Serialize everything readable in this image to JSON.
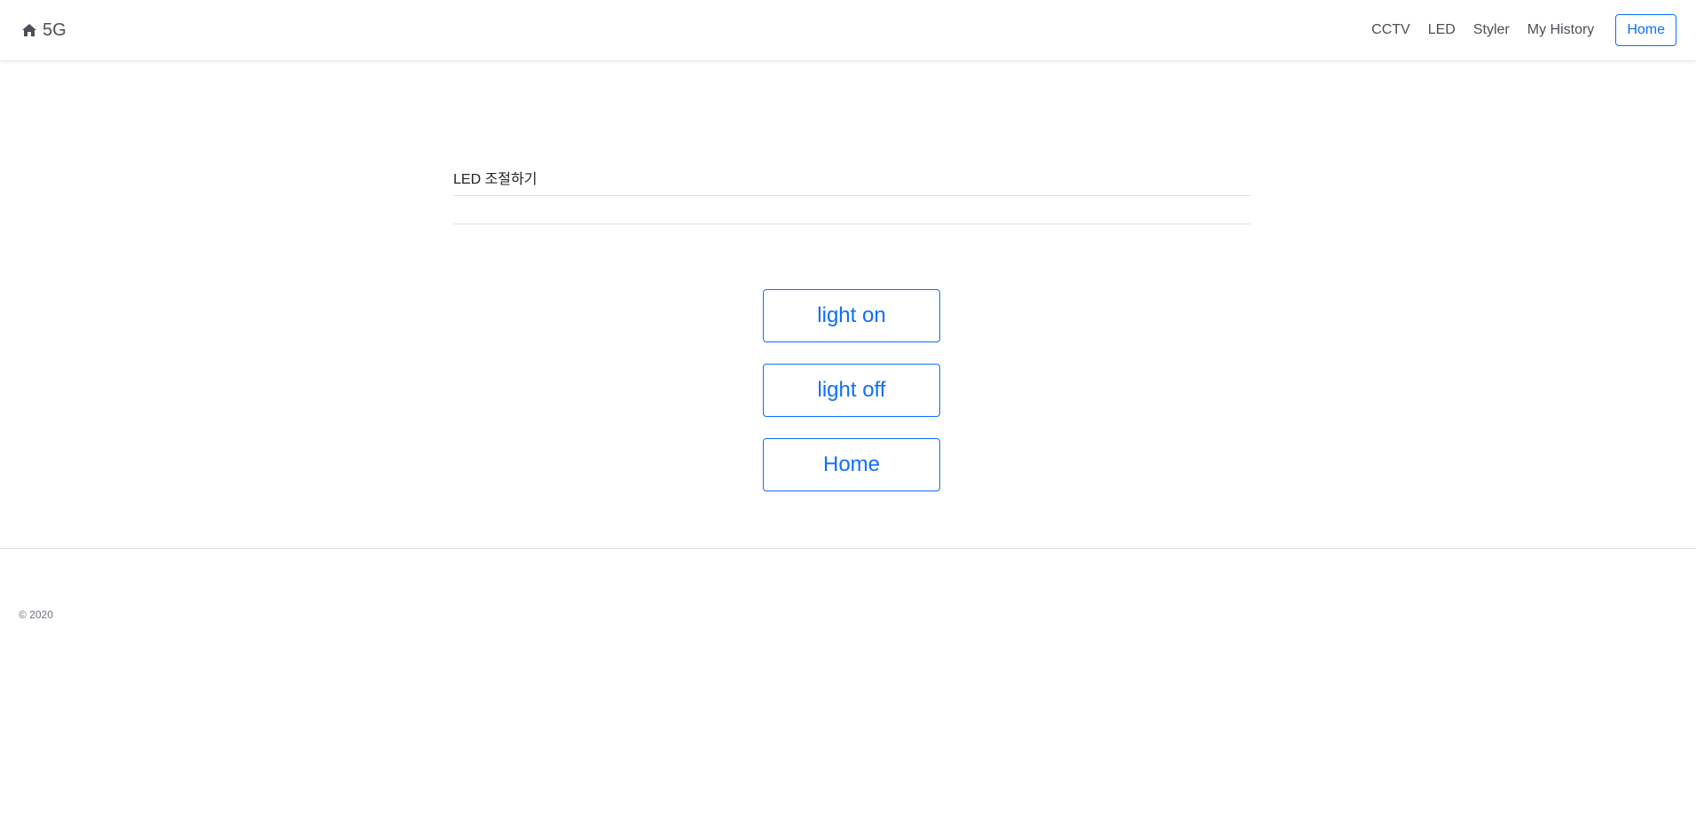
{
  "navbar": {
    "brand_icon": "home-icon",
    "brand_text": "5G",
    "links": [
      {
        "label": "CCTV"
      },
      {
        "label": "LED"
      },
      {
        "label": "Styler"
      },
      {
        "label": "My History"
      }
    ],
    "home_button": "Home"
  },
  "main": {
    "title": "LED 조절하기",
    "buttons": {
      "light_on": "light on",
      "light_off": "light off",
      "home": "Home"
    }
  },
  "footer": {
    "copyright": "© 2020"
  },
  "colors": {
    "accent": "#0d6efd",
    "text": "#495057",
    "divider": "#dee2e6"
  }
}
